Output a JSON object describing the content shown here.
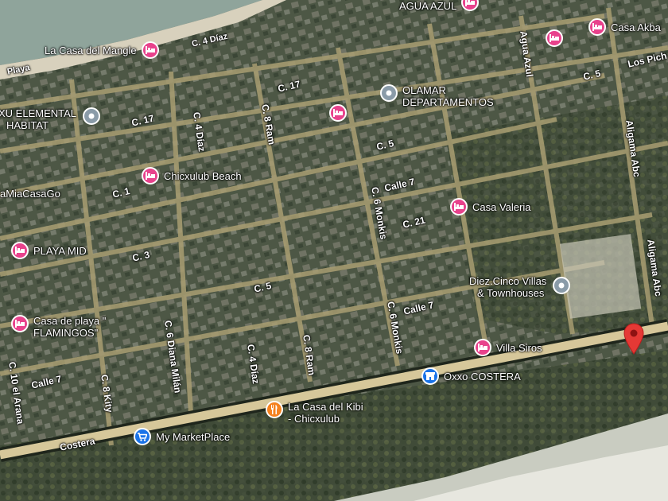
{
  "map": {
    "colors": {
      "ground": "#4a5441",
      "sea": "#8fa49b",
      "beach": "#d8d1bd",
      "road": "#a99e72",
      "highway": "#d6c79a",
      "hotel": "#e8428c",
      "generic": "#8a9ba8",
      "restaurant": "#f5821f",
      "shop": "#1a73e8",
      "pin": "#e53935"
    },
    "streets": [
      {
        "id": "c4diaz-top",
        "text": "C. 4 Díaz"
      },
      {
        "id": "playa",
        "text": "Playa"
      },
      {
        "id": "c17-a",
        "text": "C. 17"
      },
      {
        "id": "c17-b",
        "text": "C. 17"
      },
      {
        "id": "c4diaz",
        "text": "C. 4 Díaz"
      },
      {
        "id": "c8ram",
        "text": "C. 8 Ram"
      },
      {
        "id": "c5-a",
        "text": "C. 5"
      },
      {
        "id": "c5-b",
        "text": "C. 5"
      },
      {
        "id": "agua-azul",
        "text": "Agua Azul"
      },
      {
        "id": "aligama-1",
        "text": "Aligama Abc"
      },
      {
        "id": "aligama-2",
        "text": "Aligama Abc"
      },
      {
        "id": "los-pich",
        "text": "Los Pich"
      },
      {
        "id": "calle7-a",
        "text": "Calle 7"
      },
      {
        "id": "c6monkis",
        "text": "C. 6 Monkis"
      },
      {
        "id": "c21",
        "text": "C. 21"
      },
      {
        "id": "c1",
        "text": "C. 1"
      },
      {
        "id": "c3",
        "text": "C. 3"
      },
      {
        "id": "c5-c",
        "text": "C. 5"
      },
      {
        "id": "calle7-b",
        "text": "Calle 7"
      },
      {
        "id": "c6monkis-2",
        "text": "C. 6 Monkis"
      },
      {
        "id": "c6diana",
        "text": "C. 6 Diana Milán"
      },
      {
        "id": "c4diaz-2",
        "text": "C. 4 Díaz"
      },
      {
        "id": "c8ram-2",
        "text": "C. 8 Ram"
      },
      {
        "id": "calle7-c",
        "text": "Calle 7"
      },
      {
        "id": "c10",
        "text": "C. 10 el Arana"
      },
      {
        "id": "c8kity",
        "text": "C. 8 Kity"
      },
      {
        "id": "costera",
        "text": "Costera"
      }
    ],
    "places": [
      {
        "id": "agua-azul",
        "icon": "hotel",
        "lines": [
          "AGUA AZUL"
        ]
      },
      {
        "id": "casa-akba",
        "icon": "hotel",
        "lines": [
          "Casa Akba"
        ]
      },
      {
        "id": "la-casa-del-mangle",
        "icon": "hotel",
        "lines": [
          "La Casa del Mangle"
        ]
      },
      {
        "id": "hotel-unlabeled-1",
        "icon": "hotel",
        "lines": []
      },
      {
        "id": "olamar",
        "icon": "generic",
        "lines": [
          "OLAMAR",
          "DEPARTAMENTOS"
        ]
      },
      {
        "id": "xu-elemental",
        "icon": "generic",
        "lines": [
          "XU ELEMENTAL",
          "HABITAT"
        ]
      },
      {
        "id": "hotel-unlabeled-2",
        "icon": "hotel",
        "lines": []
      },
      {
        "id": "chicxulub-beach",
        "icon": "hotel",
        "lines": [
          "Chicxulub Beach"
        ]
      },
      {
        "id": "casa-valeria",
        "icon": "hotel",
        "lines": [
          "Casa Valeria"
        ]
      },
      {
        "id": "mamia",
        "icon": "none",
        "lines": [
          "aMiaCasaGo"
        ]
      },
      {
        "id": "playa-mid",
        "icon": "hotel",
        "lines": [
          "PLAYA MID"
        ]
      },
      {
        "id": "diez-cinco",
        "icon": "generic",
        "lines": [
          "Diez.Cinco Villas",
          "& Townhouses"
        ]
      },
      {
        "id": "flamingos",
        "icon": "hotel",
        "lines": [
          "Casa de playa \"",
          "FLAMINGOS\""
        ]
      },
      {
        "id": "villa-siros",
        "icon": "hotel",
        "lines": [
          "Villa Siros"
        ]
      },
      {
        "id": "oxxo",
        "icon": "shop",
        "lines": [
          "Oxxo COSTERA"
        ]
      },
      {
        "id": "kibi",
        "icon": "restaurant",
        "lines": [
          "La Casa del Kibi",
          "- Chicxulub"
        ]
      },
      {
        "id": "marketplace",
        "icon": "cart",
        "lines": [
          "My MarketPlace"
        ]
      }
    ],
    "pin": {
      "name": "selected-location-pin"
    }
  }
}
